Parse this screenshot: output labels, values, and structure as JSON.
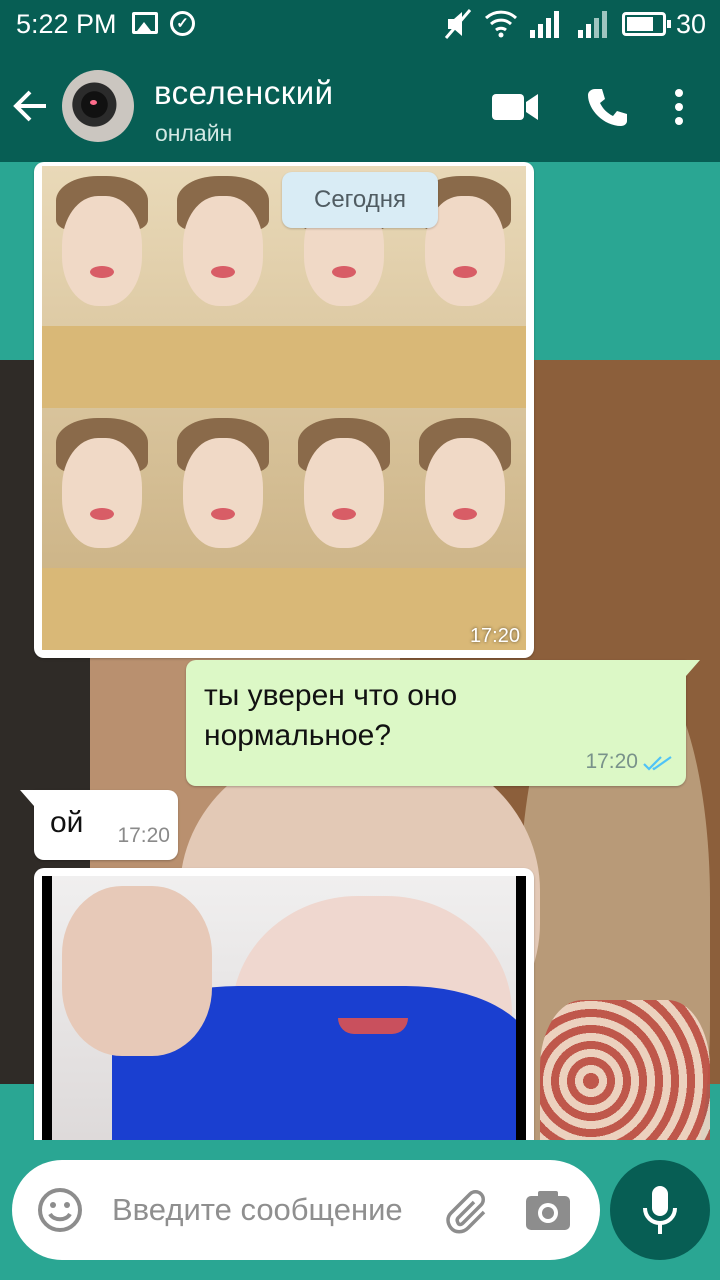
{
  "status_bar": {
    "time": "5:22 PM",
    "battery_level": "30"
  },
  "header": {
    "contact_name": "вселенский",
    "contact_status": "онлайн"
  },
  "chat": {
    "date_label": "Сегодня",
    "messages": [
      {
        "type": "image",
        "direction": "incoming",
        "time": "17:20"
      },
      {
        "type": "text",
        "direction": "outgoing",
        "text": "ты уверен что оно нормальное?",
        "time": "17:20",
        "status": "read"
      },
      {
        "type": "text",
        "direction": "incoming",
        "text": "ой",
        "time": "17:20"
      },
      {
        "type": "image",
        "direction": "incoming"
      }
    ]
  },
  "composer": {
    "placeholder": "Введите сообщение"
  },
  "icons": {
    "back": "arrow-left-icon",
    "video": "video-call-icon",
    "call": "phone-icon",
    "menu": "more-vert-icon",
    "emoji": "emoji-icon",
    "attach": "paperclip-icon",
    "camera": "camera-icon",
    "mic": "microphone-icon"
  },
  "colors": {
    "primary": "#075e54",
    "chat_bg": "#2aa693",
    "outgoing_bubble": "#dcf8c6",
    "read_ticks": "#4fc3f7"
  }
}
